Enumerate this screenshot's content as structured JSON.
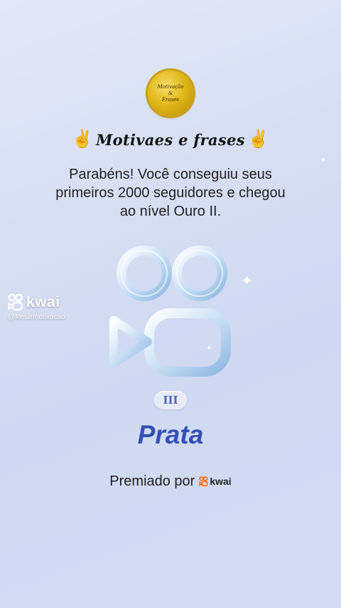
{
  "badge": {
    "line1": "Motivação",
    "line2": "&",
    "line3": "Frases"
  },
  "channel": {
    "name": "Motivaes e frases",
    "emoji_left": "✌️",
    "emoji_right": "✌️"
  },
  "message": {
    "line1": "Parabéns! Você conseguiu seus",
    "line2": "primeiros 2000 seguidores e chegou",
    "line3": "ao nível Ouro II."
  },
  "watermark": {
    "brand": "kwai",
    "handle": "@Meuirmotivacao"
  },
  "tier": {
    "level_roman": "III",
    "name": "Prata"
  },
  "awarded": {
    "label": "Premiado por",
    "brand": "kwai"
  },
  "colors": {
    "tier_text": "#3450b5",
    "kwai_logo": "#ff6a1a",
    "badge_gold": "#e2b81c"
  },
  "icons": [
    "kwai-logo-icon",
    "sparkle-icon",
    "victory-hand-icon"
  ]
}
